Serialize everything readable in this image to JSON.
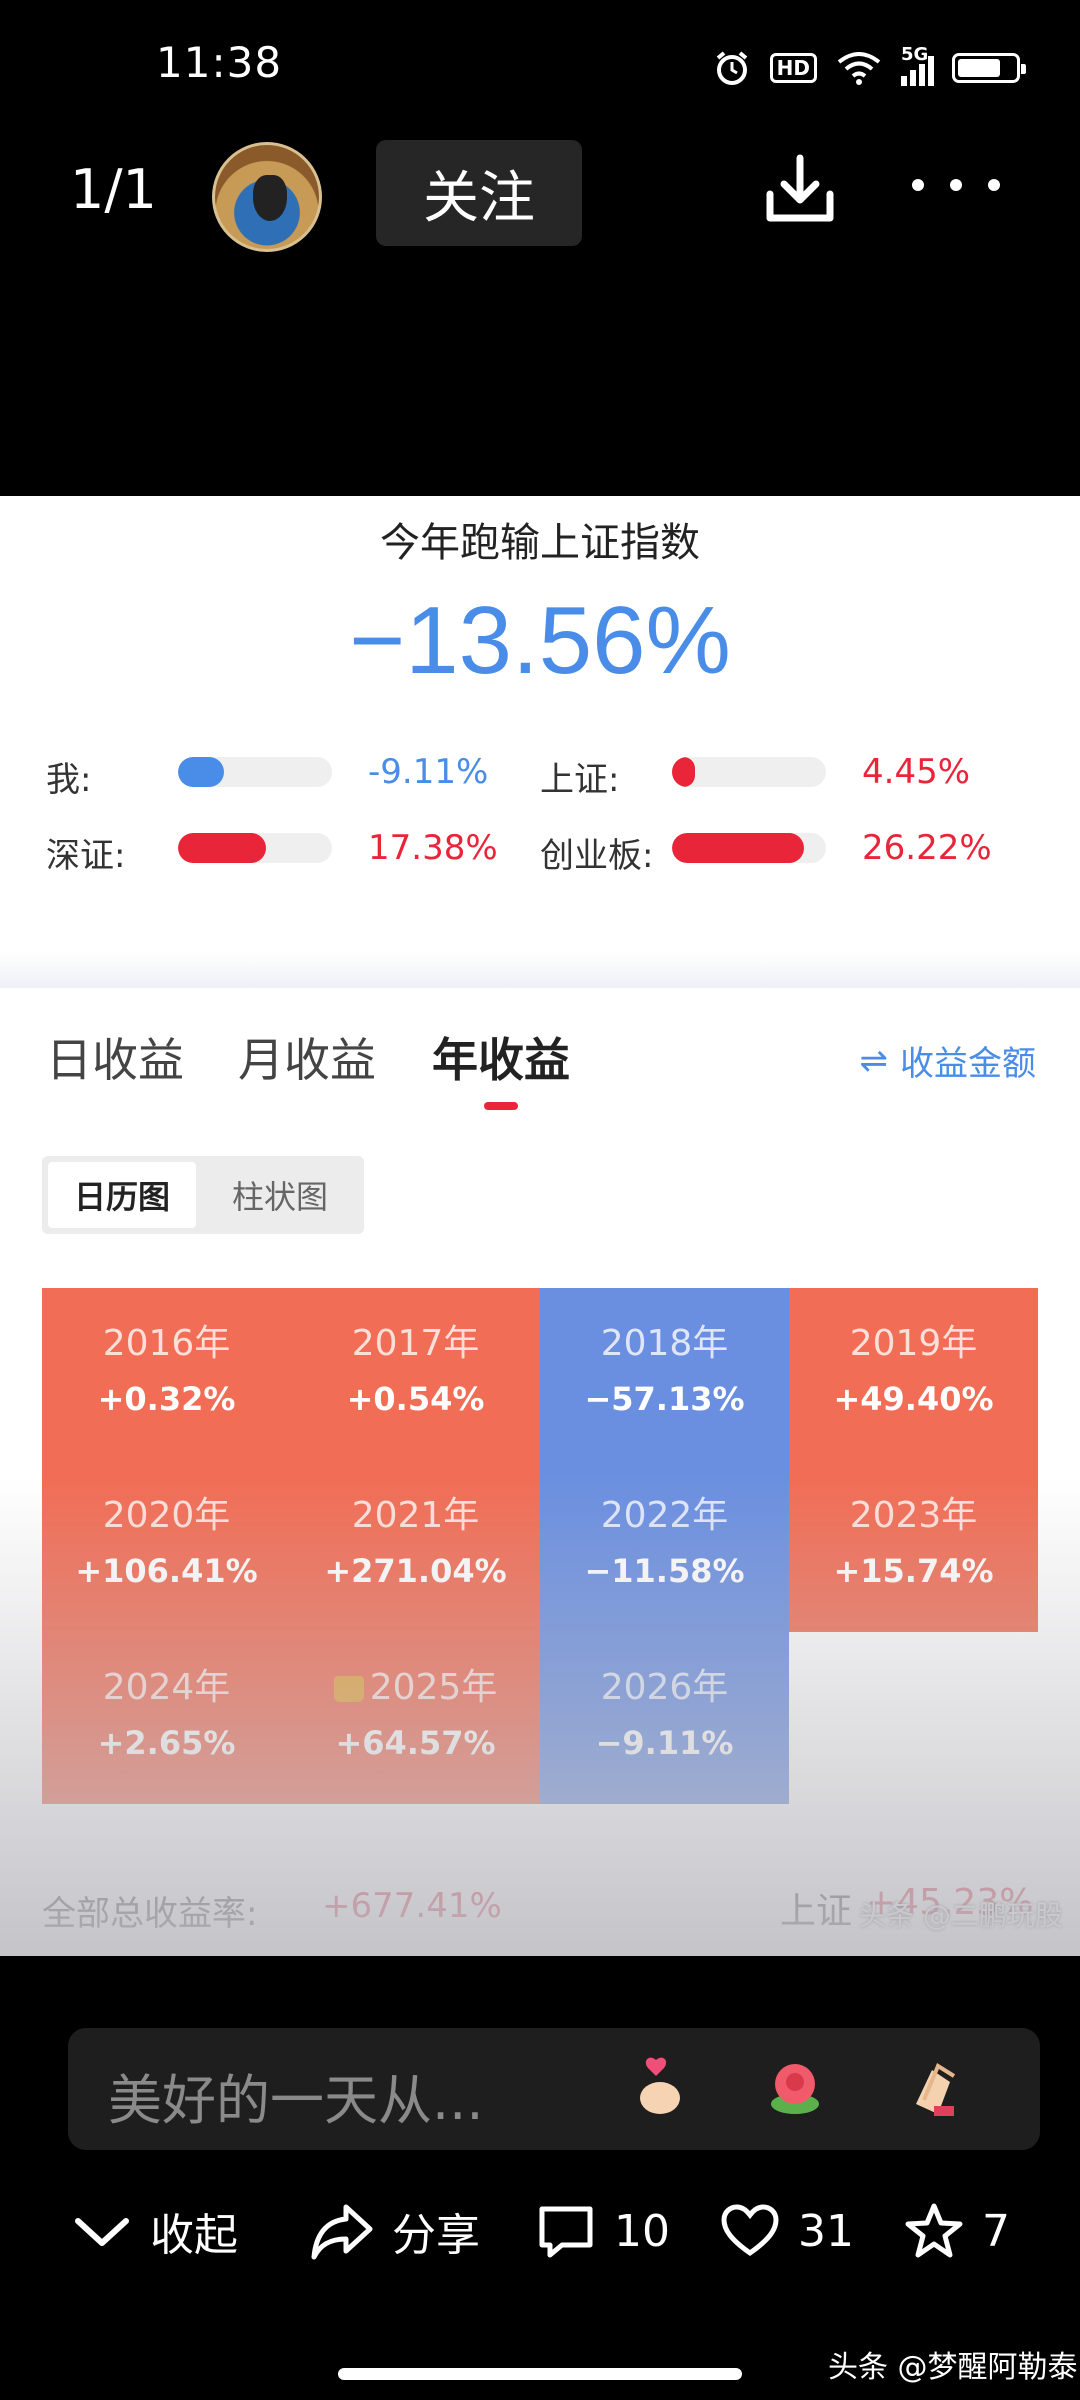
{
  "status_bar": {
    "time": "11:38",
    "hd_label": "HD",
    "network_label": "5G",
    "battery_level": 0.75
  },
  "top_bar": {
    "page_counter": "1/1",
    "follow_label": "关注",
    "icons": {
      "download": "download-icon",
      "more": "more-icon"
    }
  },
  "card": {
    "headline": "今年跑输上证指数",
    "big_value": "−13.56%",
    "comparisons": [
      {
        "label": "我:",
        "value": "-9.11%",
        "fill": 0.3,
        "color": "#4a8de8"
      },
      {
        "label": "上证:",
        "value": "4.45%",
        "fill": 0.15,
        "color": "#e9253a"
      },
      {
        "label": "深证:",
        "value": "17.38%",
        "fill": 0.57,
        "color": "#e9253a"
      },
      {
        "label": "创业板:",
        "value": "26.22%",
        "fill": 0.86,
        "color": "#e9253a"
      }
    ],
    "tabs": [
      "日收益",
      "月收益",
      "年收益"
    ],
    "active_tab": "年收益",
    "amount_toggle": "收益金额",
    "segments": [
      "日历图",
      "柱状图"
    ],
    "years": [
      {
        "year": "2016年",
        "pct": "+0.32%"
      },
      {
        "year": "2017年",
        "pct": "+0.54%"
      },
      {
        "year": "2018年",
        "pct": "−57.13%"
      },
      {
        "year": "2019年",
        "pct": "+49.40%"
      },
      {
        "year": "2020年",
        "pct": "+106.41%"
      },
      {
        "year": "2021年",
        "pct": "+271.04%"
      },
      {
        "year": "2022年",
        "pct": "−11.58%"
      },
      {
        "year": "2023年",
        "pct": "+15.74%"
      },
      {
        "year": "2024年",
        "pct": "+2.65%"
      },
      {
        "year": "2025年",
        "pct": "+64.57%"
      },
      {
        "year": "2026年",
        "pct": "−9.11%"
      }
    ],
    "total_label": "全部总收益率:",
    "total_value": "+677.41%",
    "sh_label": "上证",
    "sh_value": "+45.23%",
    "watermark": "头条 @二鹏玩股"
  },
  "comment": {
    "placeholder": "美好的一天从...",
    "emojis": [
      "finger-heart",
      "flower",
      "clap"
    ]
  },
  "actions": {
    "collapse": "收起",
    "share": "分享",
    "comments": "10",
    "likes": "31",
    "favorites": "7"
  },
  "source_watermark": "头条 @梦醒阿勒泰",
  "colors": {
    "positive": "#f16d55",
    "negative": "#6b8fe0",
    "accent_red": "#e9253a",
    "accent_blue": "#4a8de8"
  }
}
